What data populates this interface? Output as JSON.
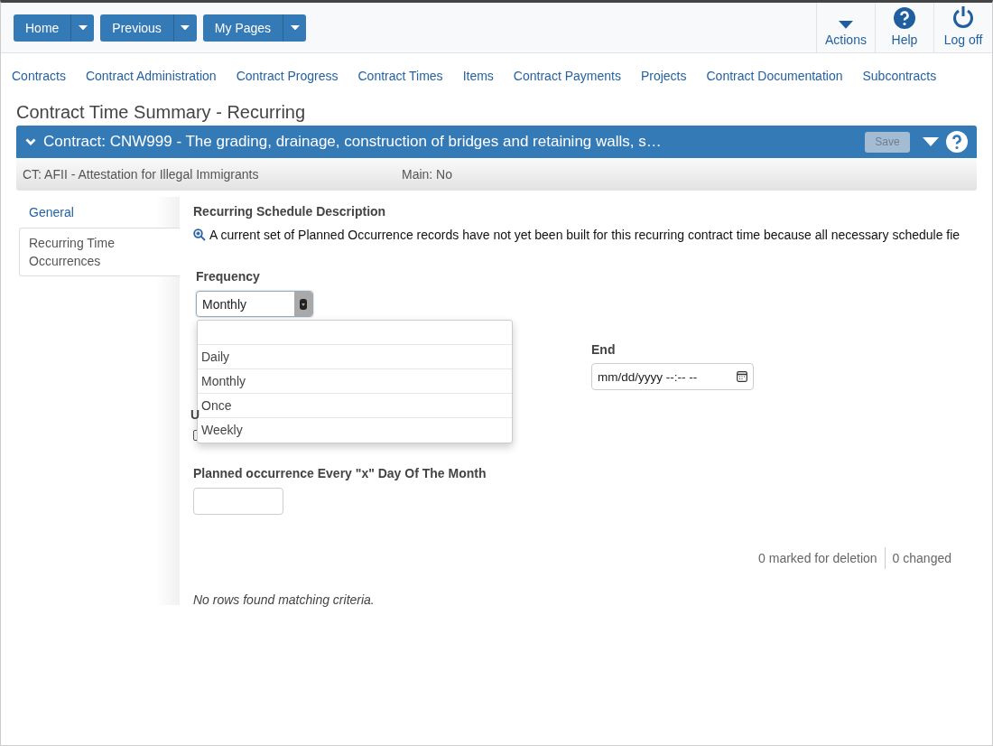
{
  "top_buttons": [
    {
      "label": "Home"
    },
    {
      "label": "Previous"
    },
    {
      "label": "My Pages"
    }
  ],
  "top_actions": [
    {
      "kind": "caret",
      "label": "Actions"
    },
    {
      "kind": "help",
      "label": "Help"
    },
    {
      "kind": "power",
      "label": "Log off"
    }
  ],
  "nav": [
    "Contracts",
    "Contract Administration",
    "Contract Progress",
    "Contract Times",
    "Items",
    "Contract Payments",
    "Projects",
    "Contract Documentation",
    "Subcontracts"
  ],
  "page_title": "Contract Time Summary - Recurring",
  "contract_bar": {
    "title": "Contract: CNW999 - The grading, drainage, construction of bridges and retaining walls, s…",
    "save": {
      "label": "Save",
      "disabled": true
    }
  },
  "sub_bar": {
    "ct": "CT: AFII - Attestation for Illegal Immigrants",
    "main": "Main: No"
  },
  "side_tabs": [
    {
      "label": "General",
      "selected": false
    },
    {
      "label": "Recurring Time Occurrences",
      "selected": true
    }
  ],
  "section_title": "Recurring Schedule Description",
  "info_text": "A current set of Planned Occurrence records have not yet been built for this recurring contract time because all necessary schedule fie",
  "frequency": {
    "label": "Frequency",
    "value": "Monthly",
    "expanded": true,
    "options": [
      "Daily",
      "Monthly",
      "Once",
      "Weekly"
    ]
  },
  "end": {
    "label": "End",
    "placeholder": "mm/dd/yyyy --:-- --"
  },
  "hidden_label": "U",
  "checkbox": {
    "checked": false
  },
  "day_of_month": {
    "label": "Planned occurrence Every \"x\" Day Of The Month"
  },
  "counts": [
    "0 marked for deletion",
    "0 changed"
  ],
  "empty_message": "No rows found matching criteria."
}
